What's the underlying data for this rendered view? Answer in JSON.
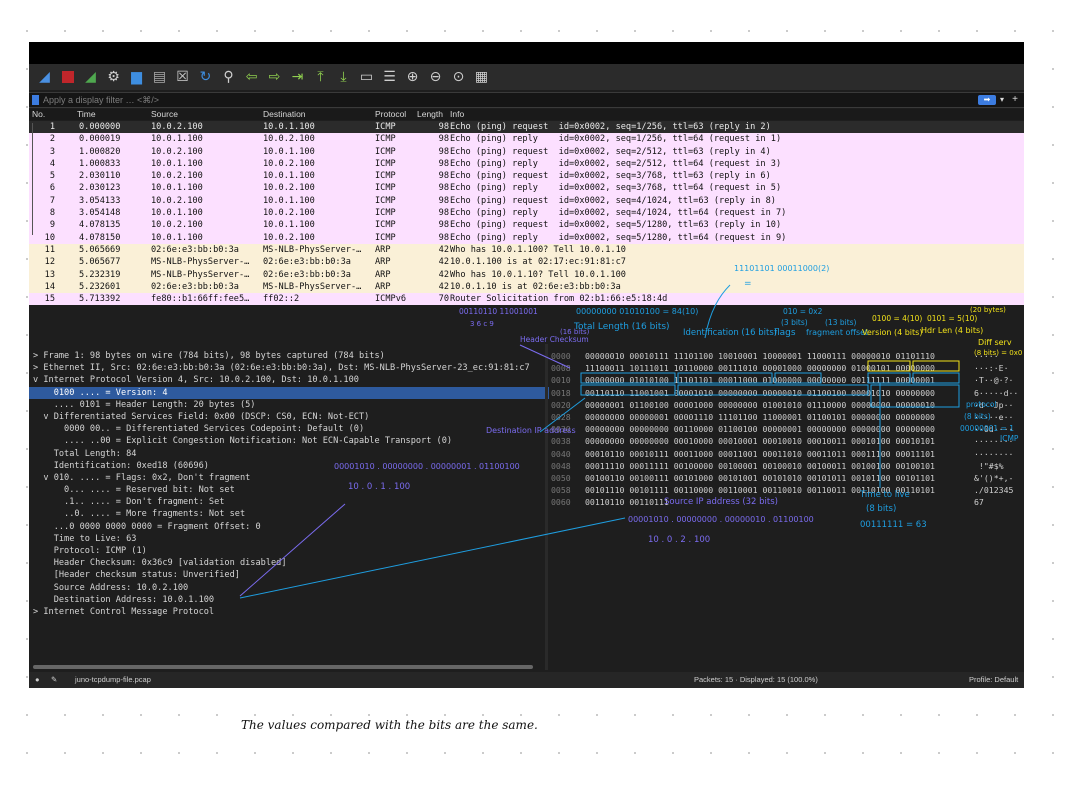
{
  "filter": {
    "placeholder": "Apply a display filter … <⌘/>"
  },
  "columns": {
    "no": "No.",
    "time": "Time",
    "source": "Source",
    "destination": "Destination",
    "protocol": "Protocol",
    "length": "Length",
    "info": "Info"
  },
  "packets": [
    {
      "no": "1",
      "time": "0.000000",
      "src": "10.0.2.100",
      "dst": "10.0.1.100",
      "proto": "ICMP",
      "len": "98",
      "info": "Echo (ping) request  id=0x0002, seq=1/256, ttl=63 (reply in 2)"
    },
    {
      "no": "2",
      "time": "0.000019",
      "src": "10.0.1.100",
      "dst": "10.0.2.100",
      "proto": "ICMP",
      "len": "98",
      "info": "Echo (ping) reply    id=0x0002, seq=1/256, ttl=64 (request in 1)"
    },
    {
      "no": "3",
      "time": "1.000820",
      "src": "10.0.2.100",
      "dst": "10.0.1.100",
      "proto": "ICMP",
      "len": "98",
      "info": "Echo (ping) request  id=0x0002, seq=2/512, ttl=63 (reply in 4)"
    },
    {
      "no": "4",
      "time": "1.000833",
      "src": "10.0.1.100",
      "dst": "10.0.2.100",
      "proto": "ICMP",
      "len": "98",
      "info": "Echo (ping) reply    id=0x0002, seq=2/512, ttl=64 (request in 3)"
    },
    {
      "no": "5",
      "time": "2.030110",
      "src": "10.0.2.100",
      "dst": "10.0.1.100",
      "proto": "ICMP",
      "len": "98",
      "info": "Echo (ping) request  id=0x0002, seq=3/768, ttl=63 (reply in 6)"
    },
    {
      "no": "6",
      "time": "2.030123",
      "src": "10.0.1.100",
      "dst": "10.0.2.100",
      "proto": "ICMP",
      "len": "98",
      "info": "Echo (ping) reply    id=0x0002, seq=3/768, ttl=64 (request in 5)"
    },
    {
      "no": "7",
      "time": "3.054133",
      "src": "10.0.2.100",
      "dst": "10.0.1.100",
      "proto": "ICMP",
      "len": "98",
      "info": "Echo (ping) request  id=0x0002, seq=4/1024, ttl=63 (reply in 8)"
    },
    {
      "no": "8",
      "time": "3.054148",
      "src": "10.0.1.100",
      "dst": "10.0.2.100",
      "proto": "ICMP",
      "len": "98",
      "info": "Echo (ping) reply    id=0x0002, seq=4/1024, ttl=64 (request in 7)"
    },
    {
      "no": "9",
      "time": "4.078135",
      "src": "10.0.2.100",
      "dst": "10.0.1.100",
      "proto": "ICMP",
      "len": "98",
      "info": "Echo (ping) request  id=0x0002, seq=5/1280, ttl=63 (reply in 10)"
    },
    {
      "no": "10",
      "time": "4.078150",
      "src": "10.0.1.100",
      "dst": "10.0.2.100",
      "proto": "ICMP",
      "len": "98",
      "info": "Echo (ping) reply    id=0x0002, seq=5/1280, ttl=64 (request in 9)"
    },
    {
      "no": "11",
      "time": "5.065669",
      "src": "02:6e:e3:bb:b0:3a",
      "dst": "MS-NLB-PhysServer-…",
      "proto": "ARP",
      "len": "42",
      "info": "Who has 10.0.1.100? Tell 10.0.1.10"
    },
    {
      "no": "12",
      "time": "5.065677",
      "src": "MS-NLB-PhysServer-…",
      "dst": "02:6e:e3:bb:b0:3a",
      "proto": "ARP",
      "len": "42",
      "info": "10.0.1.100 is at 02:17:ec:91:81:c7"
    },
    {
      "no": "13",
      "time": "5.232319",
      "src": "MS-NLB-PhysServer-…",
      "dst": "02:6e:e3:bb:b0:3a",
      "proto": "ARP",
      "len": "42",
      "info": "Who has 10.0.1.10? Tell 10.0.1.100"
    },
    {
      "no": "14",
      "time": "5.232601",
      "src": "02:6e:e3:bb:b0:3a",
      "dst": "MS-NLB-PhysServer-…",
      "proto": "ARP",
      "len": "42",
      "info": "10.0.1.10 is at 02:6e:e3:bb:b0:3a"
    },
    {
      "no": "15",
      "time": "5.713392",
      "src": "fe80::b1:66ff:fee5…",
      "dst": "ff02::2",
      "proto": "ICMPv6",
      "len": "70",
      "info": "Router Solicitation from 02:b1:66:e5:18:4d"
    }
  ],
  "details": [
    "> Frame 1: 98 bytes on wire (784 bits), 98 bytes captured (784 bits)",
    "> Ethernet II, Src: 02:6e:e3:bb:b0:3a (02:6e:e3:bb:b0:3a), Dst: MS-NLB-PhysServer-23_ec:91:81:c7",
    "v Internet Protocol Version 4, Src: 10.0.2.100, Dst: 10.0.1.100",
    "    0100 .... = Version: 4",
    "    .... 0101 = Header Length: 20 bytes (5)",
    "  v Differentiated Services Field: 0x00 (DSCP: CS0, ECN: Not-ECT)",
    "      0000 00.. = Differentiated Services Codepoint: Default (0)",
    "      .... ..00 = Explicit Congestion Notification: Not ECN-Capable Transport (0)",
    "    Total Length: 84",
    "    Identification: 0xed18 (60696)",
    "  v 010. .... = Flags: 0x2, Don't fragment",
    "      0... .... = Reserved bit: Not set",
    "      .1.. .... = Don't fragment: Set",
    "      ..0. .... = More fragments: Not set",
    "    ...0 0000 0000 0000 = Fragment Offset: 0",
    "    Time to Live: 63",
    "    Protocol: ICMP (1)",
    "    Header Checksum: 0x36c9 [validation disabled]",
    "    [Header checksum status: Unverified]",
    "    Source Address: 10.0.2.100",
    "    Destination Address: 10.0.1.100",
    "> Internet Control Message Protocol"
  ],
  "hex": [
    {
      "off": "0000",
      "bits": "00000010 00010111 11101100 10010001 10000001 11000111 00000010 01101110",
      "asc": "·····"
    },
    {
      "off": "0008",
      "bits": "11100011 10111011 10110000 00111010 00001000 00000000 01000101 00000000",
      "asc": "···:·E·"
    },
    {
      "off": "0010",
      "bits": "00000000 01010100 11101101 00011000 01000000 00000000 00111111 00000001",
      "asc": "·T··@·?·"
    },
    {
      "off": "0018",
      "bits": "00110110 11001001 00001010 00000000 00000010 01100100 00001010 00000000",
      "asc": "6·····d··"
    },
    {
      "off": "0020",
      "bits": "00000001 01100100 00001000 00000000 01001010 01110000 00000000 00000010",
      "asc": "·d··Jp··"
    },
    {
      "off": "0028",
      "bits": "00000000 00000001 00001110 11101100 11000001 01100101 00000000 00000000",
      "asc": "·····e··"
    },
    {
      "off": "0030",
      "bits": "00000000 00000000 00110000 01100100 00000001 00000000 00000000 00000000",
      "asc": "··0d····"
    },
    {
      "off": "0038",
      "bits": "00000000 00000000 00010000 00010001 00010010 00010011 00010100 00010101",
      "asc": "········"
    },
    {
      "off": "0040",
      "bits": "00010110 00010111 00011000 00011001 00011010 00011011 00011100 00011101",
      "asc": "········"
    },
    {
      "off": "0048",
      "bits": "00011110 00011111 00100000 00100001 00100010 00100011 00100100 00100101",
      "asc": " !\"#$%"
    },
    {
      "off": "0050",
      "bits": "00100110 00100111 00101000 00101001 00101010 00101011 00101100 00101101",
      "asc": "&'()*+,-"
    },
    {
      "off": "0058",
      "bits": "00101110 00101111 00110000 00110001 00110010 00110011 00110100 00110101",
      "asc": "./012345"
    },
    {
      "off": "0060",
      "bits": "00110110 00110111",
      "asc": "67"
    }
  ],
  "status": {
    "file": "juno-tcpdump-file.pcap",
    "packets": "Packets: 15 · Displayed: 15 (100.0%)",
    "profile": "Profile: Default"
  },
  "annotations": {
    "total_length_bits": "00000000 01010100 = 84(10)",
    "total_length": "Total Length (16 bits)",
    "identification": "Identification (16 bits)",
    "flags": "flags",
    "flags_bits": "(3 bits)",
    "flags_val": "010 = 0x2",
    "frag_offset": "fragment offset",
    "frag_bits": "(13 bits)",
    "version_val": "0100 = 4(10)",
    "version": "Version (4 bits)",
    "hlen_val": "0101 = 5(10)",
    "hlen": "Hdr Len (4 bits)",
    "hlen_bytes": "(20 bytes)",
    "diff_serv": "Diff serv",
    "diff_serv_bits": "(8 bits) = 0x0",
    "protocol": "protocol",
    "protocol_bits": "(8 bits)",
    "protocol_val": "00000001 = 1",
    "protocol_name": "ICMP",
    "ident_val": "11101101 00011000(2)",
    "ident_eq": "=",
    "checksum": "Header Checksum",
    "checksum_bits": "(16 bits)",
    "checksum_hex": "00110110 11001001",
    "checksum_nums": "3 6 c 9",
    "dest_ip": "Destination IP address",
    "dest_bits": "00001010 . 00000000 . 00000001 . 01100100",
    "dest_dec": "10 . 0 . 1 . 100",
    "src_ip": "Source IP address (32 bits)",
    "src_bits": "00001010 . 00000000 . 00000010 . 01100100",
    "src_dec": "10 . 0 . 2 . 100",
    "ttl": "Time to live",
    "ttl_bits": "(8 bits)",
    "ttl_val": "00111111 = 63",
    "note": "The values compared with the bits are the same."
  },
  "colors": {
    "icmp": "#fce0ff",
    "arp": "#faf0d7",
    "selected": "#2b2b2b",
    "highlight": "#2e5a9e",
    "ann_blue": "#1e9ee0",
    "ann_yellow": "#f2e21a",
    "ann_purple": "#7b6cf0"
  }
}
